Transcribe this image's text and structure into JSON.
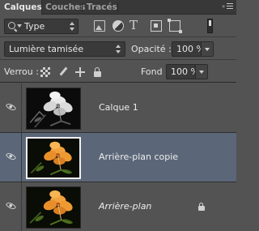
{
  "tabs": [
    {
      "label": "Calques",
      "active": true
    },
    {
      "label": "Couches",
      "active": false
    },
    {
      "label": "Tracés",
      "active": false
    }
  ],
  "filter": {
    "kind_value": "Type",
    "icons": [
      "image-filter-icon",
      "adjustment-filter-icon",
      "type-filter-icon",
      "shape-filter-icon",
      "smart-object-filter-icon"
    ]
  },
  "blend_mode": {
    "value": "Lumière tamisée"
  },
  "opacity": {
    "label": "Opacité :",
    "value": "100 %"
  },
  "lock": {
    "label": "Verrou :"
  },
  "fill": {
    "label": "Fond :",
    "value": "100 %"
  },
  "colors": {
    "panel": "#535353",
    "tabbar": "#383838",
    "selected": "#5b6779"
  },
  "layers": [
    {
      "name": "Calque 1",
      "visible": true,
      "selected": false,
      "italic": false,
      "locked": false,
      "thumbnail": "white flower on dark background (black & white)"
    },
    {
      "name": "Arrière-plan copie",
      "visible": true,
      "selected": true,
      "italic": false,
      "locked": false,
      "thumbnail": "orange hibiscus flower"
    },
    {
      "name": "Arrière-plan",
      "visible": true,
      "selected": false,
      "italic": true,
      "locked": true,
      "thumbnail": "orange hibiscus flower"
    }
  ]
}
